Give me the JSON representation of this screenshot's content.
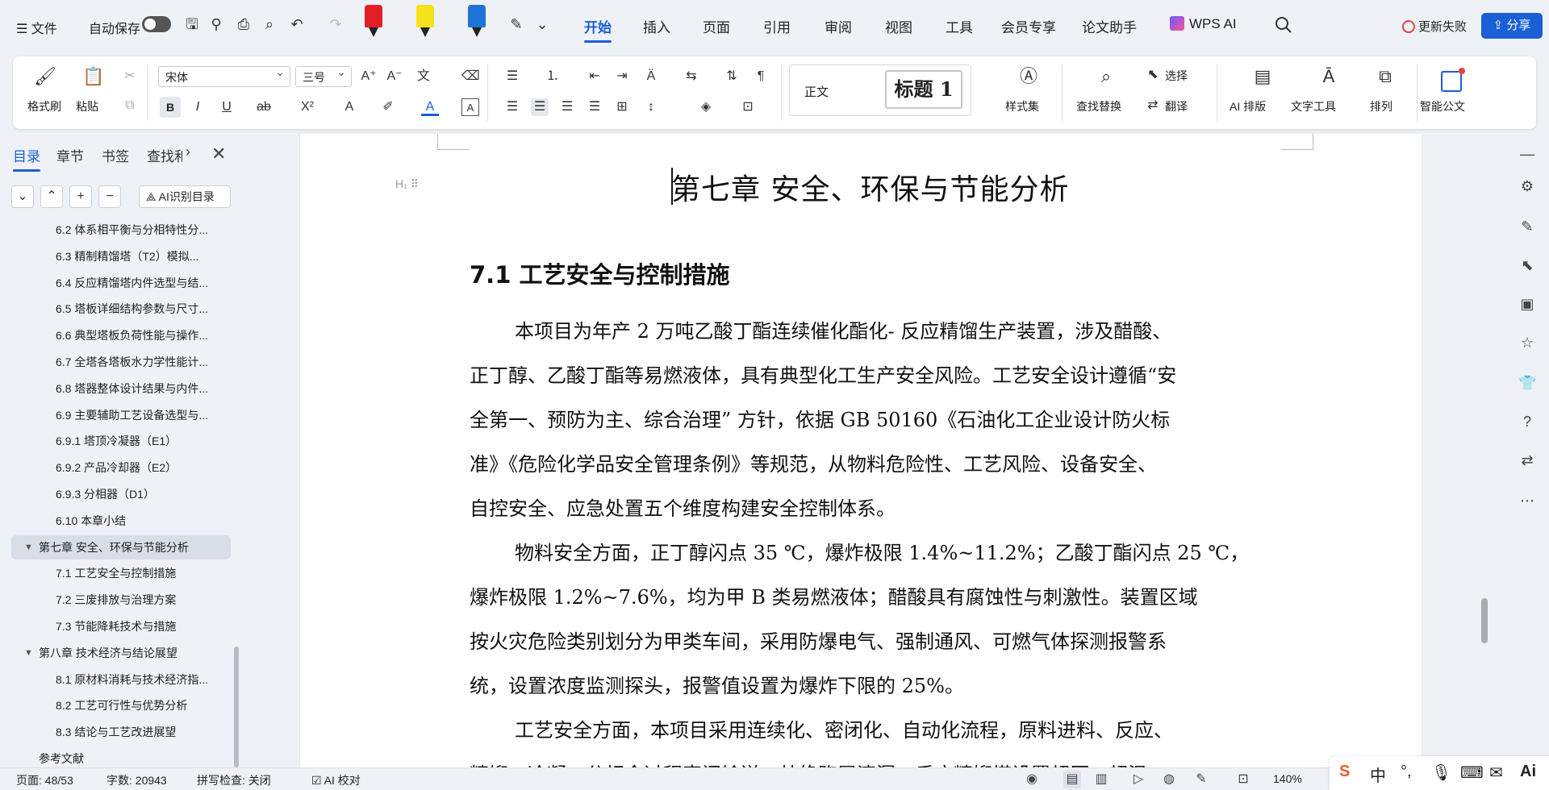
{
  "menubar": {
    "file_label": "文件",
    "autosave_label": "自动保存",
    "tabs": [
      {
        "label": "开始",
        "active": true
      },
      {
        "label": "插入"
      },
      {
        "label": "页面"
      },
      {
        "label": "引用"
      },
      {
        "label": "审阅"
      },
      {
        "label": "视图"
      },
      {
        "label": "工具"
      },
      {
        "label": "会员专享"
      },
      {
        "label": "论文助手"
      }
    ],
    "wps_ai_label": "WPS AI",
    "update_fail_label": "更新失败",
    "share_label": "分享",
    "marker_colors": [
      "#e41e26",
      "#f5e21b",
      "#1e74d6"
    ]
  },
  "ribbon": {
    "format_painter": "格式刷",
    "paste": "粘贴",
    "font_name": "宋体",
    "font_size": "三号",
    "style_normal": "正文",
    "style_heading": "标题 1",
    "style_set": "样式集",
    "find_replace": "查找替换",
    "select": "选择",
    "translate": "翻译",
    "ai_layout": "AI 排版",
    "text_tools": "文字工具",
    "arrange": "排列",
    "smart_doc": "智能公文"
  },
  "nav": {
    "tabs": [
      "目录",
      "章节",
      "书签",
      "查找和"
    ],
    "ai_dir_label": "AI识别目录",
    "toc": [
      {
        "label": "6.2 体系相平衡与分相特性分...",
        "level": 2
      },
      {
        "label": "6.3 精制精馏塔（T2）模拟...",
        "level": 2
      },
      {
        "label": "6.4 反应精馏塔内件选型与结...",
        "level": 2
      },
      {
        "label": "6.5 塔板详细结构参数与尺寸...",
        "level": 2
      },
      {
        "label": "6.6 典型塔板负荷性能与操作...",
        "level": 2
      },
      {
        "label": "6.7 全塔各塔板水力学性能计...",
        "level": 2
      },
      {
        "label": "6.8 塔器整体设计结果与内件...",
        "level": 2
      },
      {
        "label": "6.9 主要辅助工艺设备选型与...",
        "level": 2
      },
      {
        "label": "6.9.1 塔顶冷凝器（E1）",
        "level": 2
      },
      {
        "label": "6.9.2 产品冷却器（E2）",
        "level": 2
      },
      {
        "label": "6.9.3 分相器（D1）",
        "level": 2
      },
      {
        "label": "6.10 本章小结",
        "level": 2
      },
      {
        "label": "第七章 安全、环保与节能分析",
        "level": 1,
        "selected": true
      },
      {
        "label": "7.1 工艺安全与控制措施",
        "level": 2
      },
      {
        "label": "7.2 三废排放与治理方案",
        "level": 2
      },
      {
        "label": "7.3 节能降耗技术与措施",
        "level": 2
      },
      {
        "label": "第八章 技术经济与结论展望",
        "level": 1
      },
      {
        "label": "8.1 原材料消耗与技术经济指...",
        "level": 2
      },
      {
        "label": "8.2 工艺可行性与优势分析",
        "level": 2
      },
      {
        "label": "8.3 结论与工艺改进展望",
        "level": 2
      },
      {
        "label": "参考文献",
        "level": 0
      }
    ]
  },
  "document": {
    "chapter_title": "第七章  安全、环保与节能分析",
    "section_title": "7.1  工艺安全与控制措施",
    "paragraphs": [
      [
        "本项目为年产 2 万吨乙酸丁酯连续催化酯化- 反应精馏生产装置，涉及醋酸、",
        "正丁醇、乙酸丁酯等易燃液体，具有典型化工生产安全风险。工艺安全设计遵循“安",
        "全第一、预防为主、综合治理” 方针，依据 GB 50160《石油化工企业设计防火标",
        "准》《危险化学品安全管理条例》等规范，从物料危险性、工艺风险、设备安全、",
        "自控安全、应急处置五个维度构建安全控制体系。"
      ],
      [
        "物料安全方面，正丁醇闪点 35 ℃，爆炸极限 1.4%~11.2%；乙酸丁酯闪点 25 ℃，",
        "爆炸极限 1.2%~7.6%，均为甲 B 类易燃液体；醋酸具有腐蚀性与刺激性。装置区域",
        "按火灾危险类别划分为甲类车间，采用防爆电气、强制通风、可燃气体探测报警系",
        "统，设置浓度监测探头，报警值设置为爆炸下限的 25%。"
      ],
      [
        "工艺安全方面，本项目采用连续化、密闭化、自动化流程，原料进料、反应、",
        "精馏、冷凝、分相全过程密闭输送，杜绝跑冒滴漏；反应精馏塔设置超压、超温"
      ]
    ]
  },
  "status": {
    "page": "页面: 48/53",
    "words": "字数: 20943",
    "spellcheck": "拼写检查: 关闭",
    "ai_check": "AI 校对",
    "zoom": "140%"
  },
  "ime": {
    "lang": "中"
  }
}
